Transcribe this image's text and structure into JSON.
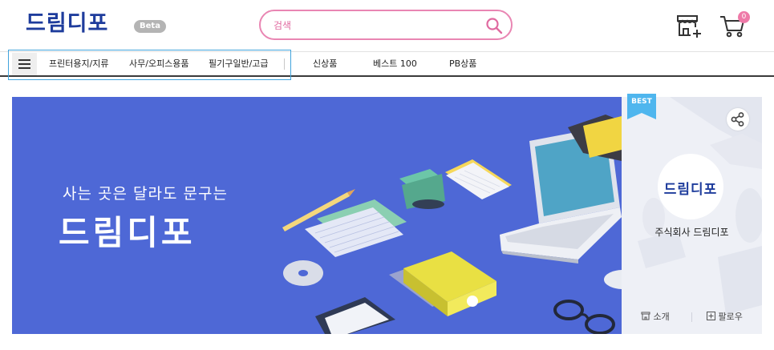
{
  "header": {
    "logo": "드림디포",
    "badge": "Beta",
    "search": {
      "placeholder": "검색",
      "value": ""
    },
    "cart_count": "0"
  },
  "nav": {
    "highlighted_items": [
      "프린터용지/지류",
      "사무/오피스용품",
      "필기구일반/고급"
    ],
    "items": [
      "신상품",
      "베스트 100",
      "PB상품"
    ]
  },
  "banner": {
    "tagline": "사는 곳은 달라도 문구는",
    "logo": "드림디포"
  },
  "seller_panel": {
    "ribbon": "BEST",
    "avatar_text": "드림디포",
    "name": "주식회사 드림디포",
    "intro_label": "소개",
    "follow_label": "팔로우"
  },
  "colors": {
    "brand_blue": "#1e3c9c",
    "banner_bg": "#4e68d6",
    "search_border": "#e986b3",
    "nav_highlight": "#41a4dc",
    "cart_badge": "#ee7aa8",
    "ribbon": "#4fb6ee"
  },
  "icons": [
    "hamburger-menu-icon",
    "search-icon",
    "store-add-icon",
    "cart-icon",
    "share-icon",
    "store-icon",
    "plus-box-icon"
  ]
}
